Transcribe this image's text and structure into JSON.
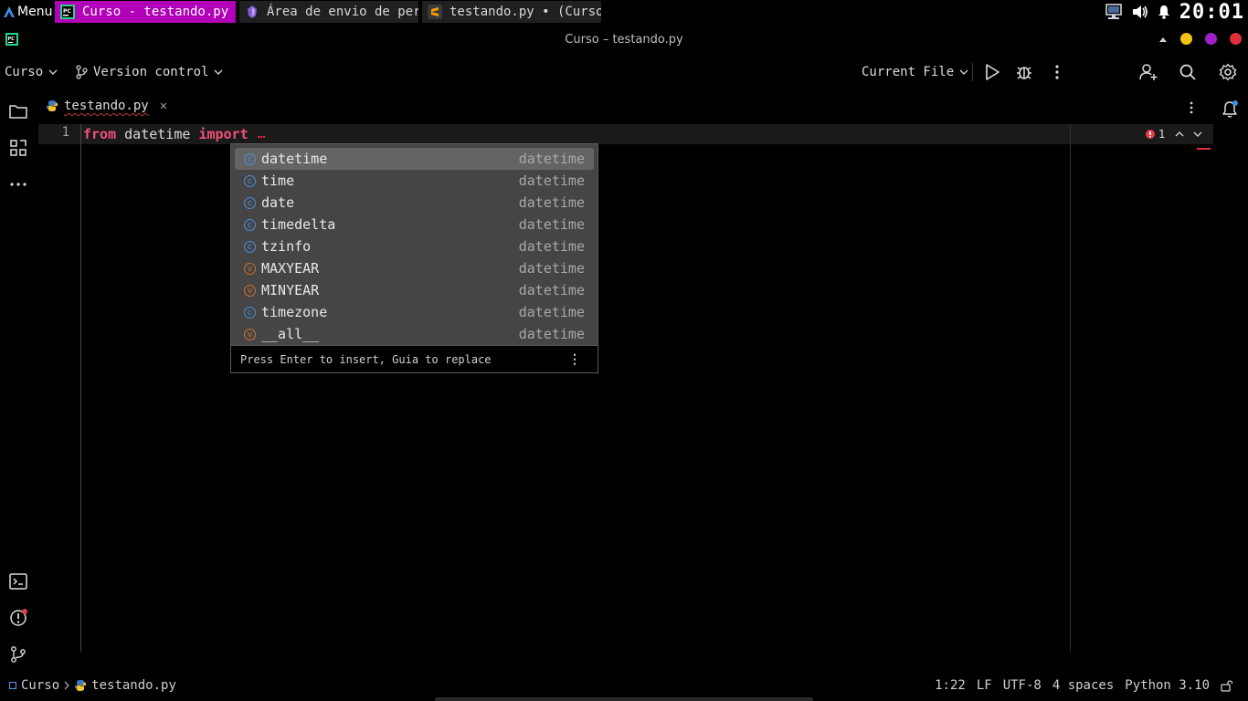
{
  "taskbar": {
    "menu_label": "Menu",
    "tasks": [
      {
        "label": "Curso - testando.py",
        "active": true,
        "icon": "pycharm-icon"
      },
      {
        "label": "Área de envio de per…",
        "active": false,
        "icon": "obsidian-icon"
      },
      {
        "label": "testando.py • (Curso…",
        "active": false,
        "icon": "sublime-icon"
      }
    ],
    "clock": "20:01",
    "tray_icons": [
      "network-icon",
      "volume-icon",
      "bell-icon"
    ]
  },
  "window": {
    "title": "Curso – testando.py",
    "controls": {
      "minimize_color": "#f5c211",
      "maximize_color": "#a020c8",
      "close_color": "#e0303a"
    }
  },
  "toolbar": {
    "project": "Curso",
    "vcs": "Version control",
    "run_config": "Current File",
    "icons": [
      "run-icon",
      "debug-icon",
      "more-vertical-icon",
      "add-user-icon",
      "search-icon",
      "settings-icon"
    ]
  },
  "sidebar": {
    "top_icons": [
      "project-folder-icon",
      "structure-icon",
      "more-horizontal-icon"
    ],
    "bottom_icons": [
      "terminal-icon",
      "problems-icon",
      "git-icon"
    ]
  },
  "editor": {
    "tab_label": "testando.py",
    "line_number": "1",
    "code": {
      "kw_from": "from",
      "module": "datetime",
      "kw_import": "import"
    },
    "inspection_count": "1"
  },
  "completion": {
    "items": [
      {
        "kind": "c",
        "name": "datetime",
        "type": "datetime",
        "selected": true
      },
      {
        "kind": "c",
        "name": "time",
        "type": "datetime"
      },
      {
        "kind": "c",
        "name": "date",
        "type": "datetime"
      },
      {
        "kind": "c",
        "name": "timedelta",
        "type": "datetime"
      },
      {
        "kind": "c",
        "name": "tzinfo",
        "type": "datetime"
      },
      {
        "kind": "v",
        "name": "MAXYEAR",
        "type": "datetime"
      },
      {
        "kind": "v",
        "name": "MINYEAR",
        "type": "datetime"
      },
      {
        "kind": "c",
        "name": "timezone",
        "type": "datetime"
      },
      {
        "kind": "v",
        "name": "__all__",
        "type": "datetime"
      }
    ],
    "badge_letters": {
      "c": "c",
      "v": "v"
    },
    "footer_hint": "Press Enter to insert, Guia to replace"
  },
  "statusbar": {
    "breadcrumb_project": "Curso",
    "breadcrumb_file": "testando.py",
    "position": "1:22",
    "line_separator": "LF",
    "encoding": "UTF-8",
    "indent": "4 spaces",
    "interpreter": "Python 3.10"
  },
  "colors": {
    "keyword": "#f0507a",
    "active_task": "#b100b8",
    "class_badge": "#4a8fd8",
    "variable_badge": "#d07030"
  }
}
